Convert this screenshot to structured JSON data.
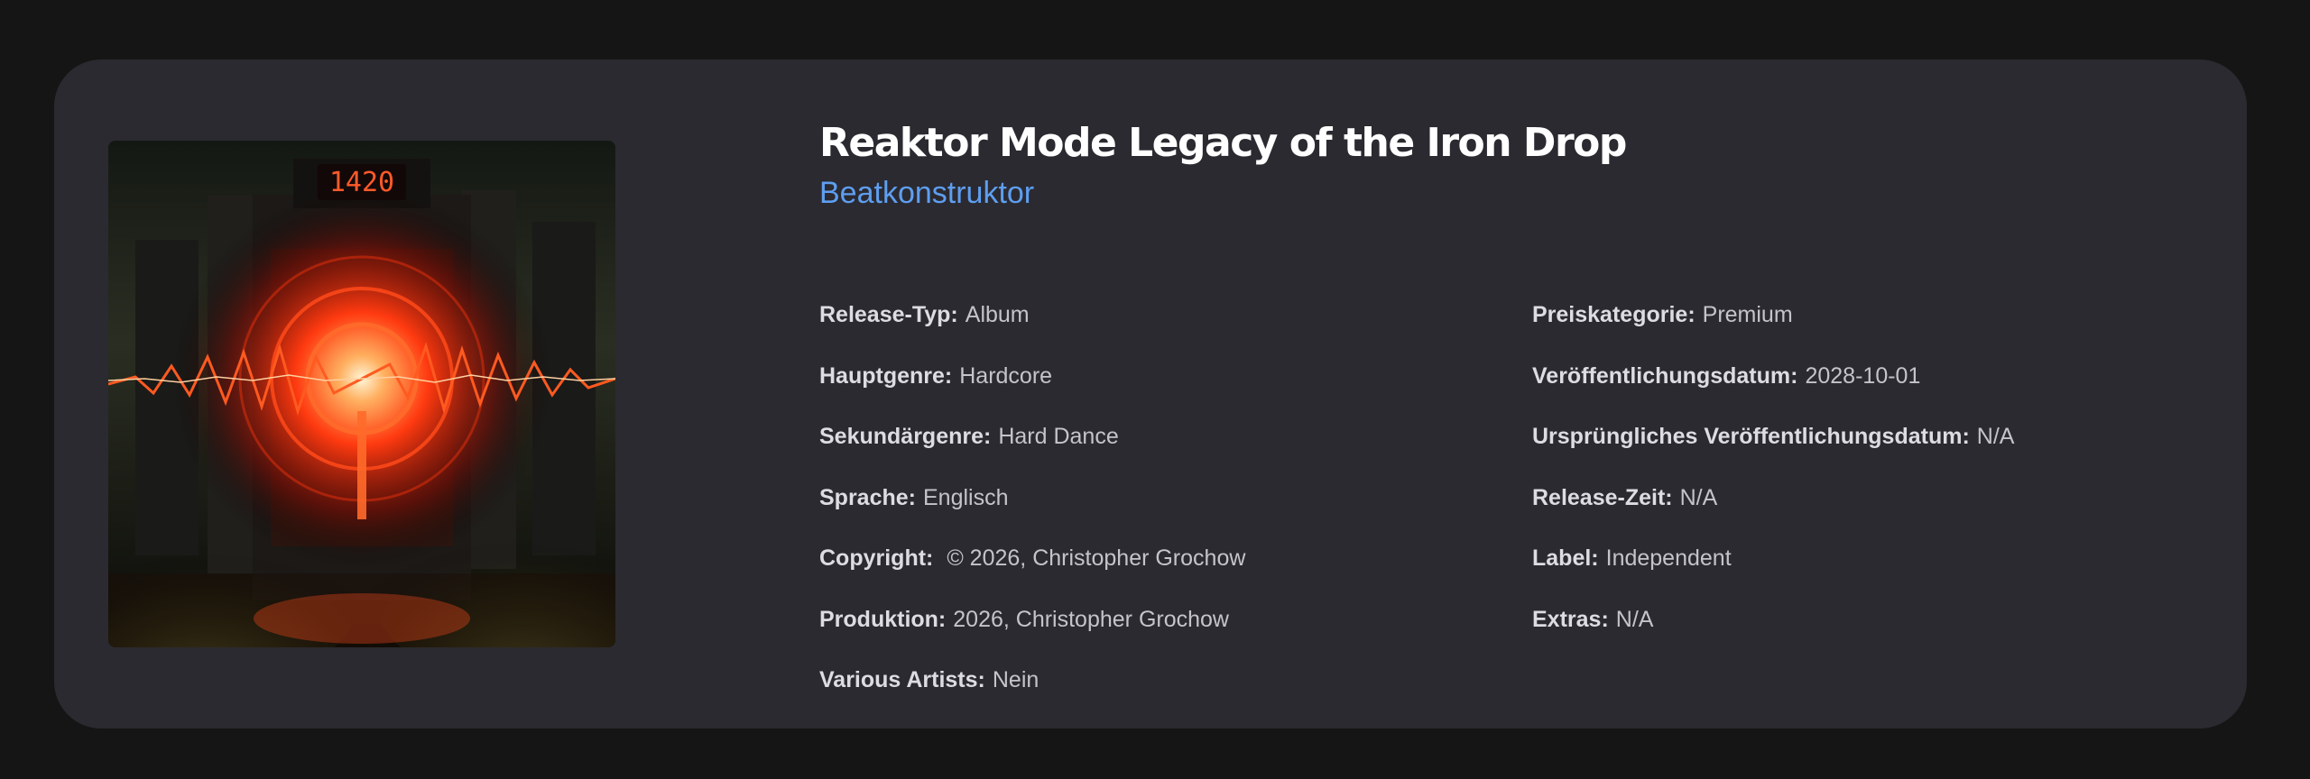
{
  "release": {
    "title": "Reaktor Mode Legacy of the Iron Drop",
    "artist": "Beatkonstruktor",
    "cover": {
      "alt": "Album cover",
      "display_text": "1420"
    }
  },
  "details_left": [
    {
      "label": "Release-Typ:",
      "value": "Album"
    },
    {
      "label": "Hauptgenre:",
      "value": "Hardcore"
    },
    {
      "label": "Sekundärgenre:",
      "value": "Hard Dance"
    },
    {
      "label": "Sprache:",
      "value": "Englisch"
    },
    {
      "label": "Copyright:",
      "value": " © 2026, Christopher Grochow"
    },
    {
      "label": "Produktion:",
      "value": "2026, Christopher Grochow"
    },
    {
      "label": "Various Artists:",
      "value": "Nein"
    }
  ],
  "details_right": [
    {
      "label": "Preiskategorie:",
      "value": "Premium"
    },
    {
      "label": "Veröffentlichungsdatum:",
      "value": "2028-10-01"
    },
    {
      "label": "Ursprüngliches Veröffentlichungsdatum:",
      "value": "N/A"
    },
    {
      "label": "Release-Zeit:",
      "value": "N/A"
    },
    {
      "label": "Label:",
      "value": "Independent"
    },
    {
      "label": "Extras:",
      "value": "N/A"
    }
  ],
  "colors": {
    "page_bg": "#151515",
    "card_bg": "#2b2a30",
    "title": "#ffffff",
    "artist_link": "#5e9ef0",
    "label_text": "#dcdce2",
    "value_text": "#c4c4ca",
    "cover_glow": "#ff4a1a"
  }
}
